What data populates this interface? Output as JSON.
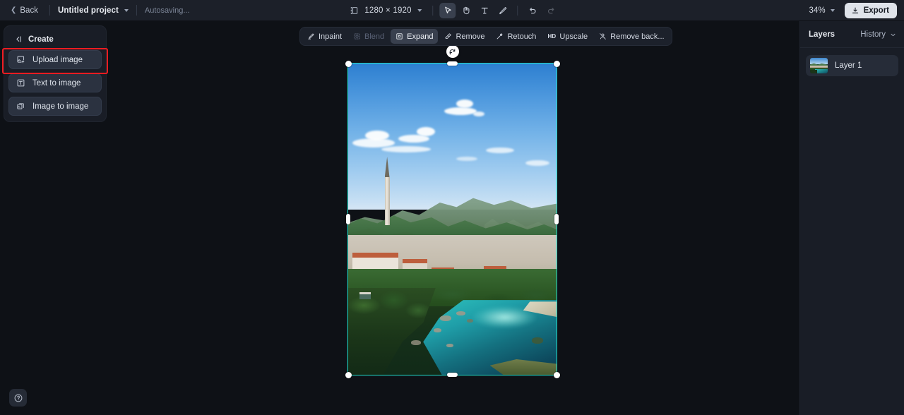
{
  "topbar": {
    "back_label": "Back",
    "project_name": "Untitled project",
    "autosave_label": "Autosaving...",
    "canvas_size": "1280 × 1920",
    "zoom_level": "34%",
    "export_label": "Export",
    "tools": [
      {
        "name": "select-tool",
        "icon": "cursor-select-icon",
        "active": true
      },
      {
        "name": "hand-tool",
        "icon": "hand-icon",
        "active": false
      },
      {
        "name": "text-tool",
        "icon": "text-icon",
        "active": false
      },
      {
        "name": "brush-tool",
        "icon": "brush-icon",
        "active": false
      }
    ],
    "history_tools": [
      {
        "name": "undo-button",
        "icon": "undo-icon",
        "disabled": false
      },
      {
        "name": "redo-button",
        "icon": "redo-icon",
        "disabled": true
      }
    ]
  },
  "create_panel": {
    "title": "Create",
    "collapse_icon": "collapse-panel-icon",
    "items": [
      {
        "label": "Upload image",
        "icon": "upload-image-icon",
        "highlighted": true
      },
      {
        "label": "Text to image",
        "icon": "text-to-image-icon",
        "highlighted": false
      },
      {
        "label": "Image to image",
        "icon": "image-to-image-icon",
        "highlighted": false
      }
    ]
  },
  "canvas_toolbar": {
    "items": [
      {
        "label": "Inpaint",
        "icon": "inpaint-icon",
        "state": "normal"
      },
      {
        "label": "Blend",
        "icon": "blend-icon",
        "state": "disabled"
      },
      {
        "label": "Expand",
        "icon": "expand-icon",
        "state": "active"
      },
      {
        "label": "Remove",
        "icon": "remove-icon",
        "state": "normal"
      },
      {
        "label": "Retouch",
        "icon": "retouch-icon",
        "state": "normal"
      },
      {
        "label": "Upscale",
        "icon": "hd-upscale-icon",
        "state": "normal"
      },
      {
        "label": "Remove back...",
        "icon": "remove-background-icon",
        "state": "normal"
      }
    ]
  },
  "canvas": {
    "selection": {
      "accent_color": "#21e0cd",
      "rotate_icon": "rotate-icon",
      "handles": [
        "top-left",
        "top-right",
        "bottom-left",
        "bottom-right",
        "top",
        "bottom",
        "left",
        "right"
      ]
    },
    "image_alt": "Aerial photo of a riverside town with church spire, green hills and turquoise river"
  },
  "layers_panel": {
    "title": "Layers",
    "history_label": "History",
    "history_icon": "chevron-down-icon",
    "layers": [
      {
        "name": "Layer 1",
        "thumbnail": "canvas-thumbnail"
      }
    ]
  },
  "help": {
    "icon": "help-question-icon"
  },
  "colors": {
    "topbar_bg": "#1c2029",
    "panel_bg": "#191d26",
    "canvas_bg": "#0e1116",
    "item_bg": "#2b3240",
    "accent_selection": "#21e0cd",
    "highlight_box": "#f01c21",
    "export_bg": "#dfe3ea"
  }
}
